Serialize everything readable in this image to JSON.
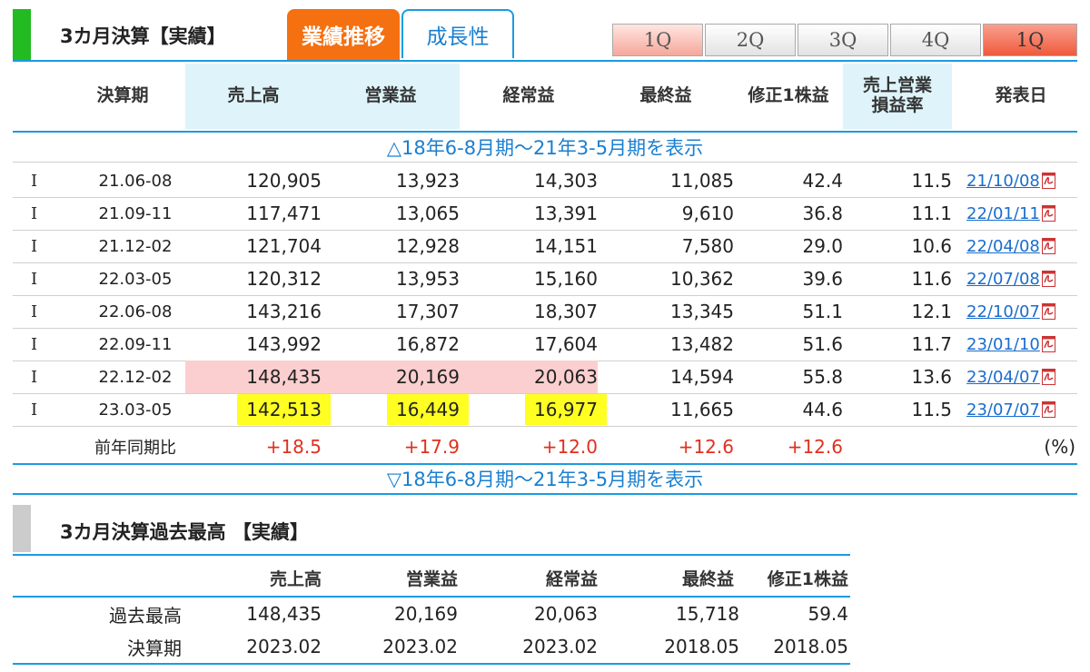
{
  "header": {
    "title": "3カ月決算【実績】",
    "tab_active": "業績推移",
    "tab_inactive": "成長性",
    "quarter_buttons": [
      "1Q",
      "2Q",
      "3Q",
      "4Q",
      "1Q"
    ]
  },
  "columns": [
    "決算期",
    "売上高",
    "営業益",
    "経常益",
    "最終益",
    "修正1株益",
    "売上営業",
    "損益率",
    "発表日"
  ],
  "toggle_top": "△18年6-8月期～21年3-5月期を表示",
  "toggle_bottom": "▽18年6-8月期～21年3-5月期を表示",
  "rows": [
    {
      "mark": "I",
      "period": "21.06-08",
      "sales": "120,905",
      "op": "13,923",
      "ord": "14,303",
      "net": "11,085",
      "eps": "42.4",
      "margin": "11.5",
      "date": "21/10/08"
    },
    {
      "mark": "I",
      "period": "21.09-11",
      "sales": "117,471",
      "op": "13,065",
      "ord": "13,391",
      "net": "9,610",
      "eps": "36.8",
      "margin": "11.1",
      "date": "22/01/11"
    },
    {
      "mark": "I",
      "period": "21.12-02",
      "sales": "121,704",
      "op": "12,928",
      "ord": "14,151",
      "net": "7,580",
      "eps": "29.0",
      "margin": "10.6",
      "date": "22/04/08"
    },
    {
      "mark": "I",
      "period": "22.03-05",
      "sales": "120,312",
      "op": "13,953",
      "ord": "15,160",
      "net": "10,362",
      "eps": "39.6",
      "margin": "11.6",
      "date": "22/07/08"
    },
    {
      "mark": "I",
      "period": "22.06-08",
      "sales": "143,216",
      "op": "17,307",
      "ord": "18,307",
      "net": "13,345",
      "eps": "51.1",
      "margin": "12.1",
      "date": "22/10/07"
    },
    {
      "mark": "I",
      "period": "22.09-11",
      "sales": "143,992",
      "op": "16,872",
      "ord": "17,604",
      "net": "13,482",
      "eps": "51.6",
      "margin": "11.7",
      "date": "23/01/10"
    },
    {
      "mark": "I",
      "period": "22.12-02",
      "sales": "148,435",
      "op": "20,169",
      "ord": "20,063",
      "net": "14,594",
      "eps": "55.8",
      "margin": "13.6",
      "date": "23/04/07"
    },
    {
      "mark": "I",
      "period": "23.03-05",
      "sales": "142,513",
      "op": "16,449",
      "ord": "16,977",
      "net": "11,665",
      "eps": "44.6",
      "margin": "11.5",
      "date": "23/07/07"
    }
  ],
  "yoy": {
    "label": "前年同期比",
    "sales": "+18.5",
    "op": "+17.9",
    "ord": "+12.0",
    "net": "+12.6",
    "eps": "+12.6",
    "unit": "(%)"
  },
  "section2": {
    "title": "3カ月決算過去最高 【実績】",
    "columns": [
      "売上高",
      "営業益",
      "経常益",
      "最終益",
      "修正1株益"
    ],
    "rows": [
      {
        "label": "過去最高",
        "values": [
          "148,435",
          "20,169",
          "20,063",
          "15,718",
          "59.4"
        ]
      },
      {
        "label": "決算期",
        "values": [
          "2023.02",
          "2023.02",
          "2023.02",
          "2018.05",
          "2018.05"
        ]
      }
    ]
  },
  "colors": {
    "accent_green": "#22bb22",
    "tab_orange": "#f57011",
    "link_blue": "#1a6dcc",
    "line_blue": "#1b9be0",
    "highlight_yellow": "#ffff22",
    "highlight_pink": "#fbcfcf",
    "increase_red": "#e0301e"
  }
}
